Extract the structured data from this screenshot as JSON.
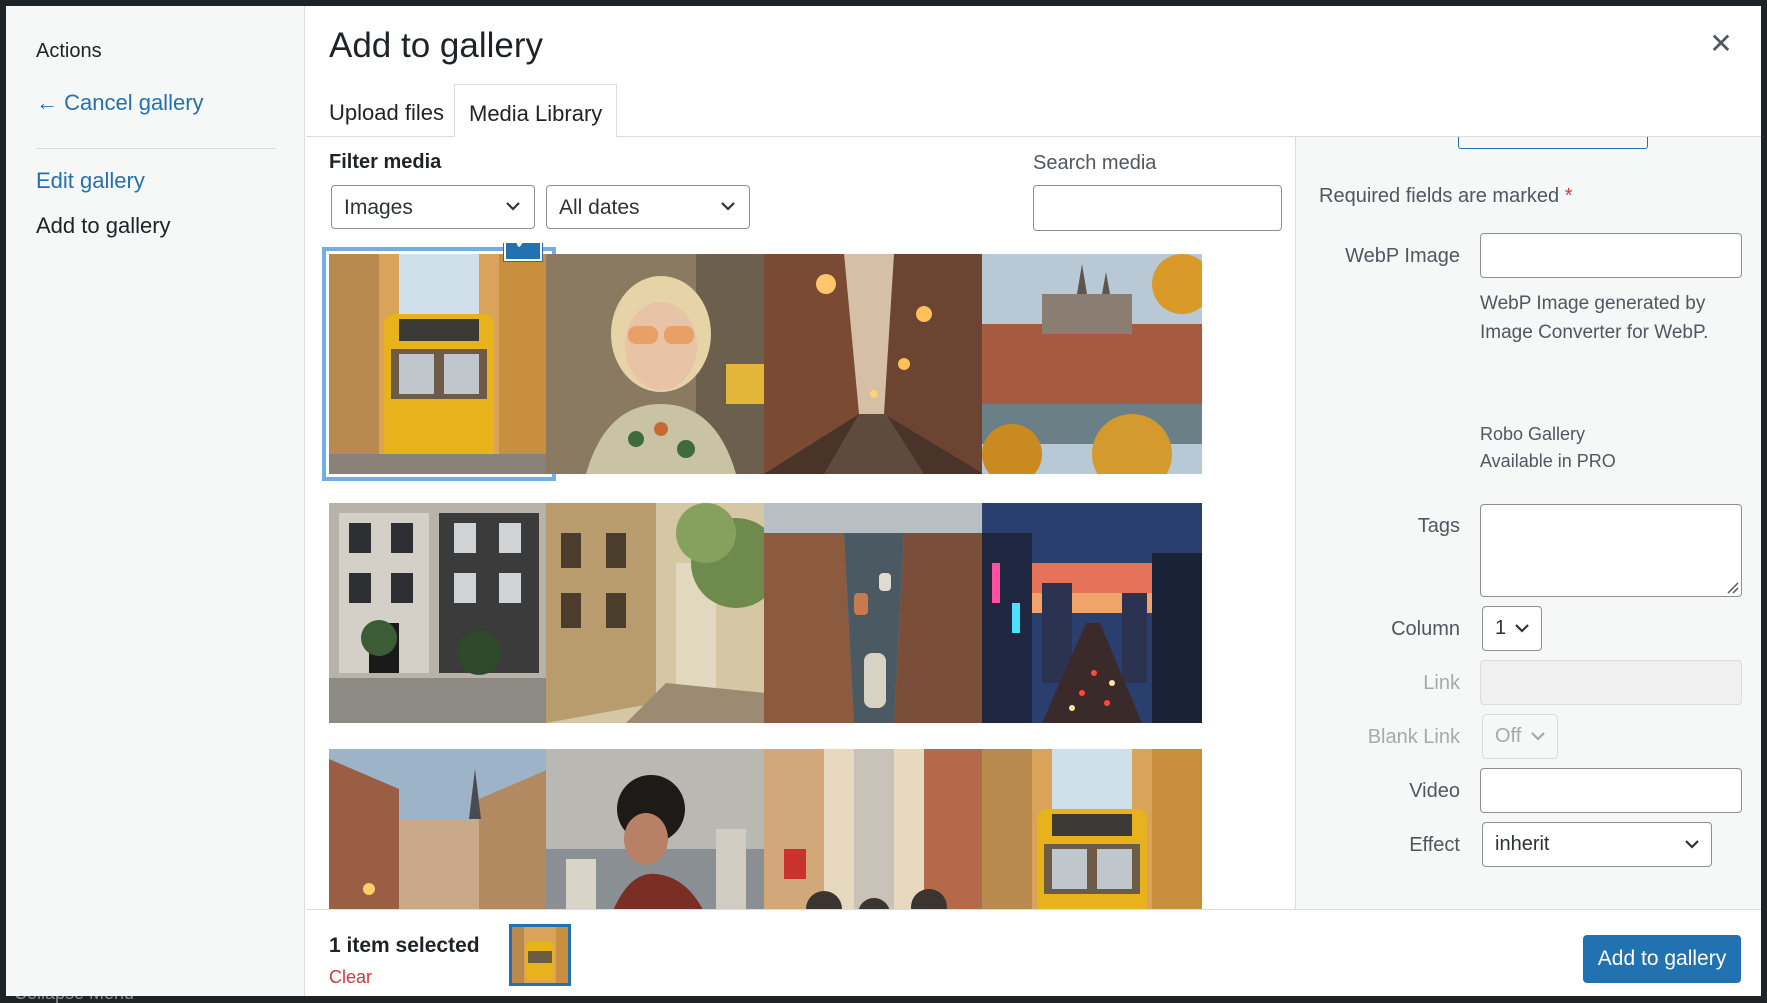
{
  "backdrop": {
    "menu_text": "Collapse Menu"
  },
  "menu": {
    "heading": "Actions",
    "cancel_link": "← Cancel gallery",
    "edit_gallery": "Edit gallery",
    "add_to_gallery": "Add to gallery"
  },
  "modal": {
    "title": "Add to gallery",
    "close_icon": "close-icon",
    "tabs": [
      {
        "label": "Upload files",
        "active": false
      },
      {
        "label": "Media Library",
        "active": true
      }
    ]
  },
  "toolbar": {
    "filter_label": "Filter media",
    "type_filter": "Images",
    "date_filter": "All dates",
    "search_label": "Search media",
    "search_value": ""
  },
  "grid": {
    "items": [
      {
        "subject": "yellow-tram",
        "selected": true
      },
      {
        "subject": "blonde-woman-sunglasses",
        "selected": false
      },
      {
        "subject": "lantern-street-evening",
        "selected": false
      },
      {
        "subject": "castle-river-city",
        "selected": false
      },
      {
        "subject": "townhouse-facade",
        "selected": false
      },
      {
        "subject": "paris-street-trees",
        "selected": false
      },
      {
        "subject": "canal-boats-city",
        "selected": false
      },
      {
        "subject": "city-avenue-sunset",
        "selected": false
      },
      {
        "subject": "old-town-street",
        "selected": false
      },
      {
        "subject": "woman-rooftop-city",
        "selected": false
      },
      {
        "subject": "people-walking-city",
        "selected": false
      },
      {
        "subject": "yellow-tram-2",
        "selected": false
      }
    ]
  },
  "sidebar": {
    "required_note": "Required fields are marked",
    "required_star": "*",
    "webp_label": "WebP Image",
    "webp_value": "",
    "webp_desc": "WebP Image generated by Image Converter for WebP.",
    "robo_line1": "Robo Gallery",
    "robo_line2": "Available in PRO",
    "tags_label": "Tags",
    "column_label": "Column",
    "column_value": "1",
    "link_label": "Link",
    "blank_link_label": "Blank Link",
    "blank_link_value": "Off",
    "video_label": "Video",
    "effect_label": "Effect",
    "effect_value": "inherit"
  },
  "footer": {
    "selected_count": "1 item selected",
    "clear_label": "Clear",
    "primary_button": "Add to gallery"
  },
  "colors": {
    "accent": "#2271b1",
    "danger": "#d63638"
  }
}
